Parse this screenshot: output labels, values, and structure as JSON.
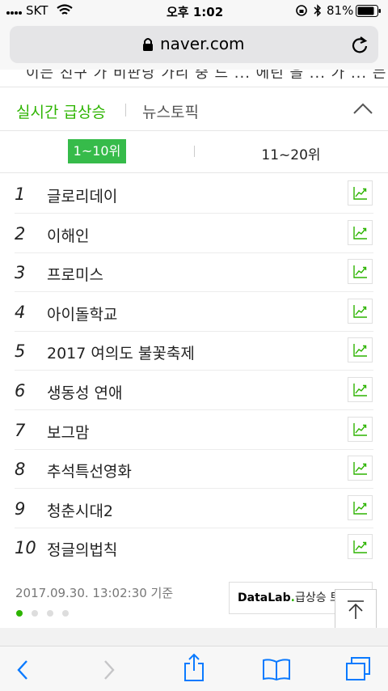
{
  "status": {
    "carrier": "SKT",
    "time": "오후 1:02",
    "battery": "81%"
  },
  "browser": {
    "url": "naver.com"
  },
  "cut_text": "이는 친구 가 비판당 가리 중 드 ... 에린 을 ... 가 ... 는 한 기",
  "topic_tabs": {
    "realtime": "실시간 급상승",
    "news": "뉴스토픽"
  },
  "range_tabs": {
    "first": "1~10위",
    "second": "11~20위"
  },
  "ranks": [
    {
      "rank": "1",
      "keyword": "글로리데이"
    },
    {
      "rank": "2",
      "keyword": "이해인"
    },
    {
      "rank": "3",
      "keyword": "프로미스"
    },
    {
      "rank": "4",
      "keyword": "아이돌학교"
    },
    {
      "rank": "5",
      "keyword": "2017 여의도 불꽃축제"
    },
    {
      "rank": "6",
      "keyword": "생동성 연애"
    },
    {
      "rank": "7",
      "keyword": "보그맘"
    },
    {
      "rank": "8",
      "keyword": "추석특선영화"
    },
    {
      "rank": "9",
      "keyword": "청춘시대2"
    },
    {
      "rank": "10",
      "keyword": "정글의법칙"
    }
  ],
  "footer": {
    "timestamp": "2017.09.30. 13:02:30 기준",
    "datalab_brand": "DataLab",
    "datalab_dot": ".",
    "datalab_suffix": "급상승 트렌드"
  },
  "colors": {
    "accent_green": "#2db400",
    "active_tab_bg": "#36bb4a"
  },
  "icons": {
    "wifi": "wifi-icon",
    "lock": "lock-icon",
    "reload": "reload-icon",
    "chevron_up": "chevron-up-icon",
    "trend": "trend-chart-icon",
    "scroll_top": "arrow-up-icon",
    "back": "back-icon",
    "forward": "forward-icon",
    "share": "share-icon",
    "bookmarks": "bookmarks-icon",
    "tabs": "tabs-icon"
  }
}
